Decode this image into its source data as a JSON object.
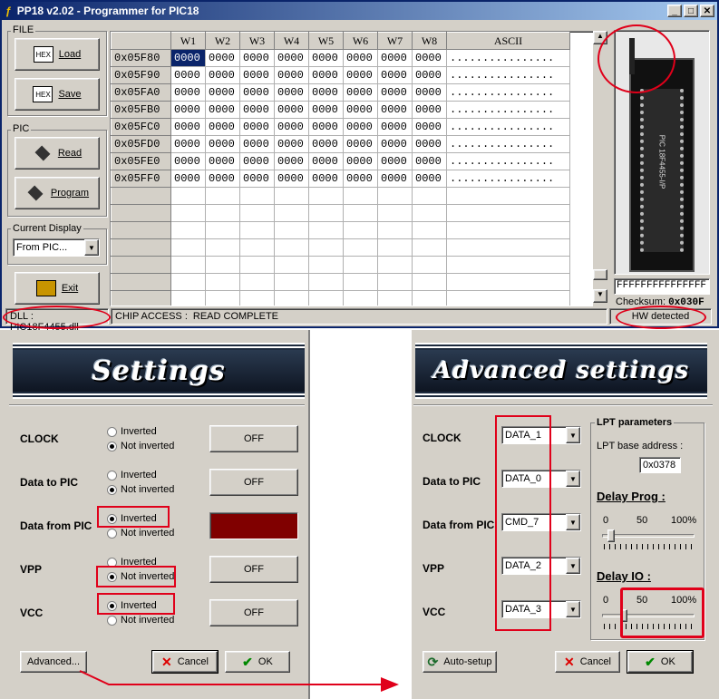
{
  "main_window": {
    "title": "PP18 v2.02 - Programmer for PIC18",
    "file_group": "FILE",
    "load": "Load",
    "save": "Save",
    "pic_group": "PIC",
    "read": "Read",
    "program": "Program",
    "display_group": "Current Display",
    "display_value": "From PIC...",
    "exit": "Exit",
    "columns": [
      "",
      "W1",
      "W2",
      "W3",
      "W4",
      "W5",
      "W6",
      "W7",
      "W8",
      "ASCII"
    ],
    "rows": [
      {
        "addr": "0x05F80",
        "cells": [
          "0000",
          "0000",
          "0000",
          "0000",
          "0000",
          "0000",
          "0000",
          "0000"
        ],
        "ascii": "................"
      },
      {
        "addr": "0x05F90",
        "cells": [
          "0000",
          "0000",
          "0000",
          "0000",
          "0000",
          "0000",
          "0000",
          "0000"
        ],
        "ascii": "................"
      },
      {
        "addr": "0x05FA0",
        "cells": [
          "0000",
          "0000",
          "0000",
          "0000",
          "0000",
          "0000",
          "0000",
          "0000"
        ],
        "ascii": "................"
      },
      {
        "addr": "0x05FB0",
        "cells": [
          "0000",
          "0000",
          "0000",
          "0000",
          "0000",
          "0000",
          "0000",
          "0000"
        ],
        "ascii": "................"
      },
      {
        "addr": "0x05FC0",
        "cells": [
          "0000",
          "0000",
          "0000",
          "0000",
          "0000",
          "0000",
          "0000",
          "0000"
        ],
        "ascii": "................"
      },
      {
        "addr": "0x05FD0",
        "cells": [
          "0000",
          "0000",
          "0000",
          "0000",
          "0000",
          "0000",
          "0000",
          "0000"
        ],
        "ascii": "................"
      },
      {
        "addr": "0x05FE0",
        "cells": [
          "0000",
          "0000",
          "0000",
          "0000",
          "0000",
          "0000",
          "0000",
          "0000"
        ],
        "ascii": "................"
      },
      {
        "addr": "0x05FF0",
        "cells": [
          "0000",
          "0000",
          "0000",
          "0000",
          "0000",
          "0000",
          "0000",
          "0000"
        ],
        "ascii": "................"
      }
    ],
    "config_value": "FFFFFFFFFFFFFFF",
    "checksum_label": "Checksum:",
    "checksum_value": "0x030F",
    "status_dll": "DLL : PIC18F4455.dll",
    "status_access": "CHIP ACCESS :",
    "status_result": "READ COMPLETE",
    "status_hw": "HW detected",
    "chip_text": "PIC 18F4455-I/P"
  },
  "settings": {
    "banner": "Settings",
    "rows": [
      {
        "label": "CLOCK",
        "opt1": "Inverted",
        "opt2": "Not inverted",
        "selected": 2,
        "button": "OFF"
      },
      {
        "label": "Data to PIC",
        "opt1": "Inverted",
        "opt2": "Not inverted",
        "selected": 2,
        "button": "OFF"
      },
      {
        "label": "Data from PIC",
        "opt1": "Inverted",
        "opt2": "Not inverted",
        "selected": 1,
        "button": ""
      },
      {
        "label": "VPP",
        "opt1": "Inverted",
        "opt2": "Not inverted",
        "selected": 2,
        "button": "OFF"
      },
      {
        "label": "VCC",
        "opt1": "Inverted",
        "opt2": "Not inverted",
        "selected": 1,
        "button": "OFF"
      }
    ],
    "advanced": "Advanced...",
    "cancel": "Cancel",
    "ok": "OK"
  },
  "advanced": {
    "banner": "Advanced settings",
    "rows": [
      {
        "label": "CLOCK",
        "value": "DATA_1"
      },
      {
        "label": "Data to PIC",
        "value": "DATA_0"
      },
      {
        "label": "Data from PIC",
        "value": "CMD_7"
      },
      {
        "label": "VPP",
        "value": "DATA_2"
      },
      {
        "label": "VCC",
        "value": "DATA_3"
      }
    ],
    "lpt_group": "LPT parameters",
    "lpt_base_label": "LPT base address :",
    "lpt_base_value": "0x0378",
    "delay_prog": "Delay Prog :",
    "delay_io": "Delay IO :",
    "scale_min": "0",
    "scale_mid": "50",
    "scale_max": "100%",
    "auto_setup": "Auto-setup",
    "cancel": "Cancel",
    "ok": "OK"
  },
  "colors": {
    "annotation_red": "#e0001a",
    "data_from_pic_indicator": "#800000",
    "title_blue": "#0a246a"
  }
}
